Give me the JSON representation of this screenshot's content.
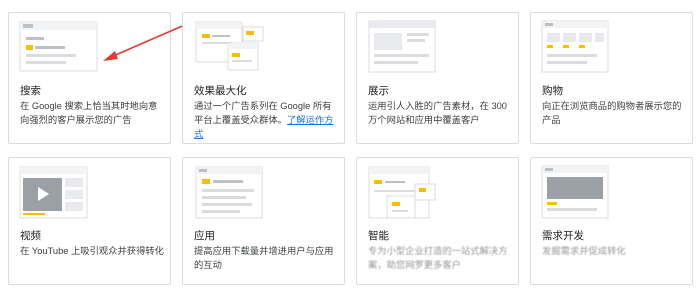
{
  "cards": [
    {
      "title": "搜索",
      "desc": "在 Google 搜索上恰当其时地向意向强烈的客户展示您的广告"
    },
    {
      "title": "效果最大化",
      "desc": "通过一个广告系列在 Google 所有平台上覆盖受众群体。",
      "link": "了解运作方式"
    },
    {
      "title": "展示",
      "desc": "运用引人入胜的广告素材，在 300 万个网站和应用中覆盖客户"
    },
    {
      "title": "购物",
      "desc": "向正在浏览商品的购物者展示您的产品"
    },
    {
      "title": "视频",
      "desc": "在 YouTube 上吸引观众并获得转化"
    },
    {
      "title": "应用",
      "desc": "提高应用下载量并增进用户与应用的互动"
    },
    {
      "title": "智能",
      "desc": "专为小型企业打造的一站式解决方案，助您网罗更多客户"
    },
    {
      "title": "需求开发",
      "desc": "发掘需求并促成转化"
    }
  ],
  "colors": {
    "accent": "#fbbc04",
    "link": "#1a73e8",
    "arrow": "#e53935",
    "border": "#dadce0"
  }
}
